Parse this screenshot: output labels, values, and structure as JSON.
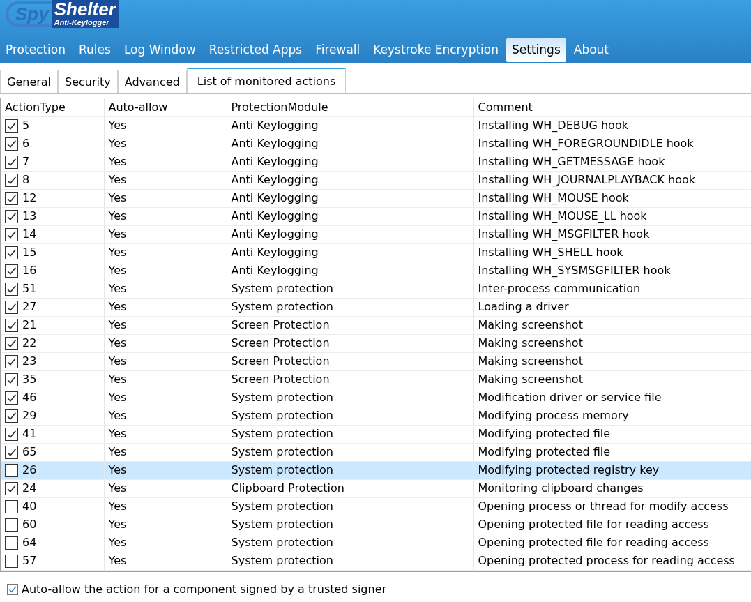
{
  "logo": {
    "prefix": "Spy",
    "name": "Shelter",
    "tagline": "Anti-Keylogger"
  },
  "menu": [
    {
      "label": "Protection",
      "selected": false
    },
    {
      "label": "Rules",
      "selected": false
    },
    {
      "label": "Log Window",
      "selected": false
    },
    {
      "label": "Restricted Apps",
      "selected": false
    },
    {
      "label": "Firewall",
      "selected": false
    },
    {
      "label": "Keystroke Encryption",
      "selected": false
    },
    {
      "label": "Settings",
      "selected": true
    },
    {
      "label": "About",
      "selected": false
    }
  ],
  "tabs": [
    {
      "label": "General",
      "selected": false
    },
    {
      "label": "Security",
      "selected": false
    },
    {
      "label": "Advanced",
      "selected": false
    },
    {
      "label": "List of monitored actions",
      "selected": true
    }
  ],
  "table": {
    "columns": [
      "ActionType",
      "Auto-allow",
      "ProtectionModule",
      "Comment"
    ],
    "rows": [
      {
        "checked": true,
        "selected": false,
        "cells": [
          "5",
          "Yes",
          "Anti Keylogging",
          "Installing WH_DEBUG hook"
        ]
      },
      {
        "checked": true,
        "selected": false,
        "cells": [
          "6",
          "Yes",
          "Anti Keylogging",
          "Installing WH_FOREGROUNDIDLE hook"
        ]
      },
      {
        "checked": true,
        "selected": false,
        "cells": [
          "7",
          "Yes",
          "Anti Keylogging",
          "Installing WH_GETMESSAGE hook"
        ]
      },
      {
        "checked": true,
        "selected": false,
        "cells": [
          "8",
          "Yes",
          "Anti Keylogging",
          "Installing WH_JOURNALPLAYBACK hook"
        ]
      },
      {
        "checked": true,
        "selected": false,
        "cells": [
          "12",
          "Yes",
          "Anti Keylogging",
          "Installing WH_MOUSE hook"
        ]
      },
      {
        "checked": true,
        "selected": false,
        "cells": [
          "13",
          "Yes",
          "Anti Keylogging",
          "Installing WH_MOUSE_LL hook"
        ]
      },
      {
        "checked": true,
        "selected": false,
        "cells": [
          "14",
          "Yes",
          "Anti Keylogging",
          "Installing WH_MSGFILTER hook"
        ]
      },
      {
        "checked": true,
        "selected": false,
        "cells": [
          "15",
          "Yes",
          "Anti Keylogging",
          "Installing WH_SHELL hook"
        ]
      },
      {
        "checked": true,
        "selected": false,
        "cells": [
          "16",
          "Yes",
          "Anti Keylogging",
          "Installing WH_SYSMSGFILTER hook"
        ]
      },
      {
        "checked": true,
        "selected": false,
        "cells": [
          "51",
          "Yes",
          "System protection",
          "Inter-process communication"
        ]
      },
      {
        "checked": true,
        "selected": false,
        "cells": [
          "27",
          "Yes",
          "System protection",
          "Loading a driver"
        ]
      },
      {
        "checked": true,
        "selected": false,
        "cells": [
          "21",
          "Yes",
          "Screen Protection",
          "Making screenshot"
        ]
      },
      {
        "checked": true,
        "selected": false,
        "cells": [
          "22",
          "Yes",
          "Screen Protection",
          "Making screenshot"
        ]
      },
      {
        "checked": true,
        "selected": false,
        "cells": [
          "23",
          "Yes",
          "Screen Protection",
          "Making screenshot"
        ]
      },
      {
        "checked": true,
        "selected": false,
        "cells": [
          "35",
          "Yes",
          "Screen Protection",
          "Making screenshot"
        ]
      },
      {
        "checked": true,
        "selected": false,
        "cells": [
          "46",
          "Yes",
          "System protection",
          "Modification driver or service file"
        ]
      },
      {
        "checked": true,
        "selected": false,
        "cells": [
          "29",
          "Yes",
          "System protection",
          "Modifying process memory"
        ]
      },
      {
        "checked": true,
        "selected": false,
        "cells": [
          "41",
          "Yes",
          "System protection",
          "Modifying protected file"
        ]
      },
      {
        "checked": true,
        "selected": false,
        "cells": [
          "65",
          "Yes",
          "System protection",
          "Modifying protected file"
        ]
      },
      {
        "checked": false,
        "selected": true,
        "cells": [
          "26",
          "Yes",
          "System protection",
          "Modifying protected registry key"
        ]
      },
      {
        "checked": true,
        "selected": false,
        "cells": [
          "24",
          "Yes",
          "Clipboard Protection",
          "Monitoring clipboard changes"
        ]
      },
      {
        "checked": false,
        "selected": false,
        "cells": [
          "40",
          "Yes",
          "System protection",
          "Opening process or thread for modify access"
        ]
      },
      {
        "checked": false,
        "selected": false,
        "cells": [
          "60",
          "Yes",
          "System protection",
          "Opening protected file for reading access"
        ]
      },
      {
        "checked": false,
        "selected": false,
        "cells": [
          "64",
          "Yes",
          "System protection",
          "Opening protected file for reading access"
        ]
      },
      {
        "checked": false,
        "selected": false,
        "cells": [
          "57",
          "Yes",
          "System protection",
          "Opening protected process for reading access"
        ]
      }
    ]
  },
  "trusted_signer_option": {
    "label": "Auto-allow the action for a component signed by a trusted signer",
    "checked": true
  }
}
